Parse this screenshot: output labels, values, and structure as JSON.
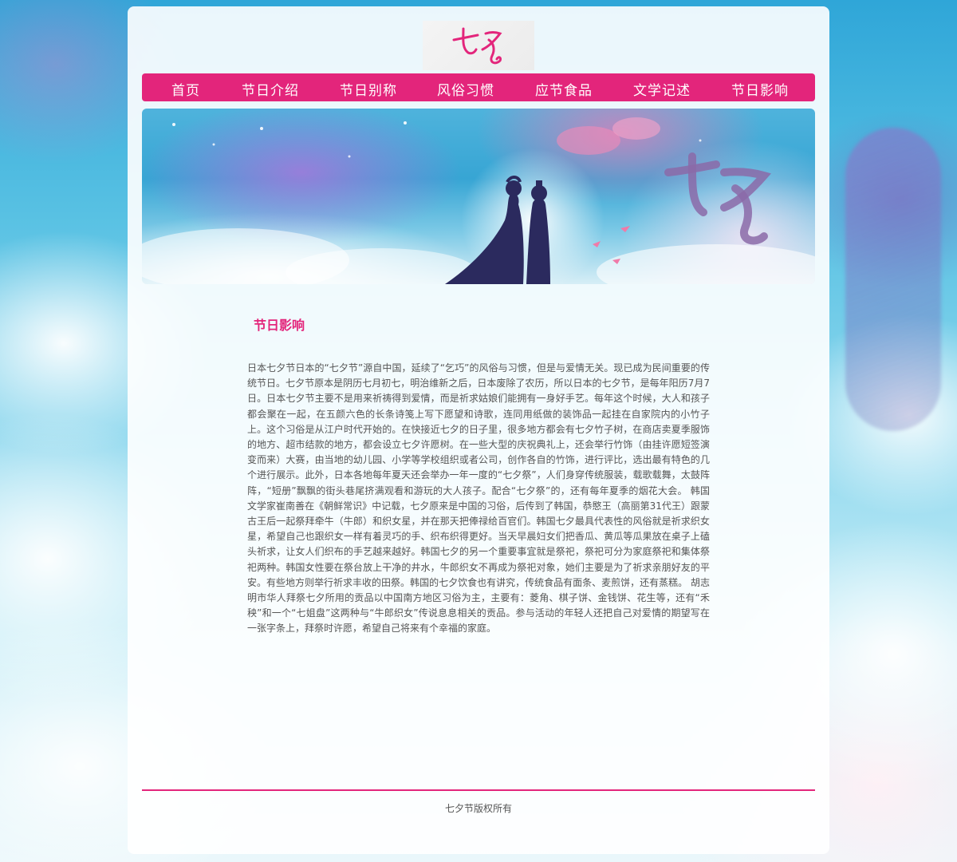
{
  "logo": {
    "text": "七夕"
  },
  "nav": {
    "items": [
      "首页",
      "节日介绍",
      "节日别称",
      "风俗习惯",
      "应节食品",
      "文学记述",
      "节日影响"
    ]
  },
  "banner": {
    "title": "七夕"
  },
  "article": {
    "heading": "节日影响",
    "body": "日本七夕节日本的“七夕节”源自中国，延续了“乞巧”的风俗与习惯，但是与爱情无关。现已成为民间重要的传统节日。七夕节原本是阴历七月初七，明治维新之后，日本废除了农历，所以日本的七夕节，是每年阳历7月7日。日本七夕节主要不是用来祈祷得到爱情，而是祈求姑娘们能拥有一身好手艺。每年这个时候，大人和孩子都会聚在一起，在五颜六色的长条诗笺上写下愿望和诗歌，连同用纸做的装饰品一起挂在自家院内的小竹子上。这个习俗是从江户时代开始的。在快接近七夕的日子里，很多地方都会有七夕竹子树，在商店卖夏季服饰的地方、超市结款的地方，都会设立七夕许愿树。在一些大型的庆祝典礼上，还会举行竹饰（由挂许愿短签演变而来）大赛，由当地的幼儿园、小学等学校组织或者公司，创作各自的竹饰，进行评比，选出最有特色的几个进行展示。此外，日本各地每年夏天还会举办一年一度的“七夕祭”，人们身穿传统服装，载歌载舞，太鼓阵阵，“短册”飘飘的街头巷尾挤满观看和游玩的大人孩子。配合“七夕祭”的，还有每年夏季的烟花大会。 韩国文学家崔南善在《朝鲜常识》中记载，七夕原来是中国的习俗，后传到了韩国，恭愍王（高丽第31代王）跟蒙古王后一起祭拜牵牛（牛郎）和织女星，并在那天把俸禄给百官们。韩国七夕最具代表性的风俗就是祈求织女星，希望自己也跟织女一样有着灵巧的手、织布织得更好。当天早晨妇女们把香瓜、黄瓜等瓜果放在桌子上磕头祈求，让女人们织布的手艺越来越好。韩国七夕的另一个重要事宜就是祭祀，祭祀可分为家庭祭祀和集体祭祀两种。韩国女性要在祭台放上干净的井水，牛郎织女不再成为祭祀对象，她们主要是为了祈求亲朋好友的平安。有些地方则举行祈求丰收的田祭。韩国的七夕饮食也有讲究，传统食品有面条、麦煎饼，还有蒸糕。 胡志明市华人拜祭七夕所用的贡品以中国南方地区习俗为主，主要有：菱角、棋子饼、金钱饼、花生等，还有“禾秧”和一个“七姐盘”这两种与“牛郎织女”传说息息相关的贡品。参与活动的年轻人还把自己对爱情的期望写在一张字条上，拜祭时许愿，希望自己将来有个幸福的家庭。"
  },
  "footer": {
    "text": "七夕节版权所有"
  },
  "colors": {
    "accent": "#e3257b"
  }
}
